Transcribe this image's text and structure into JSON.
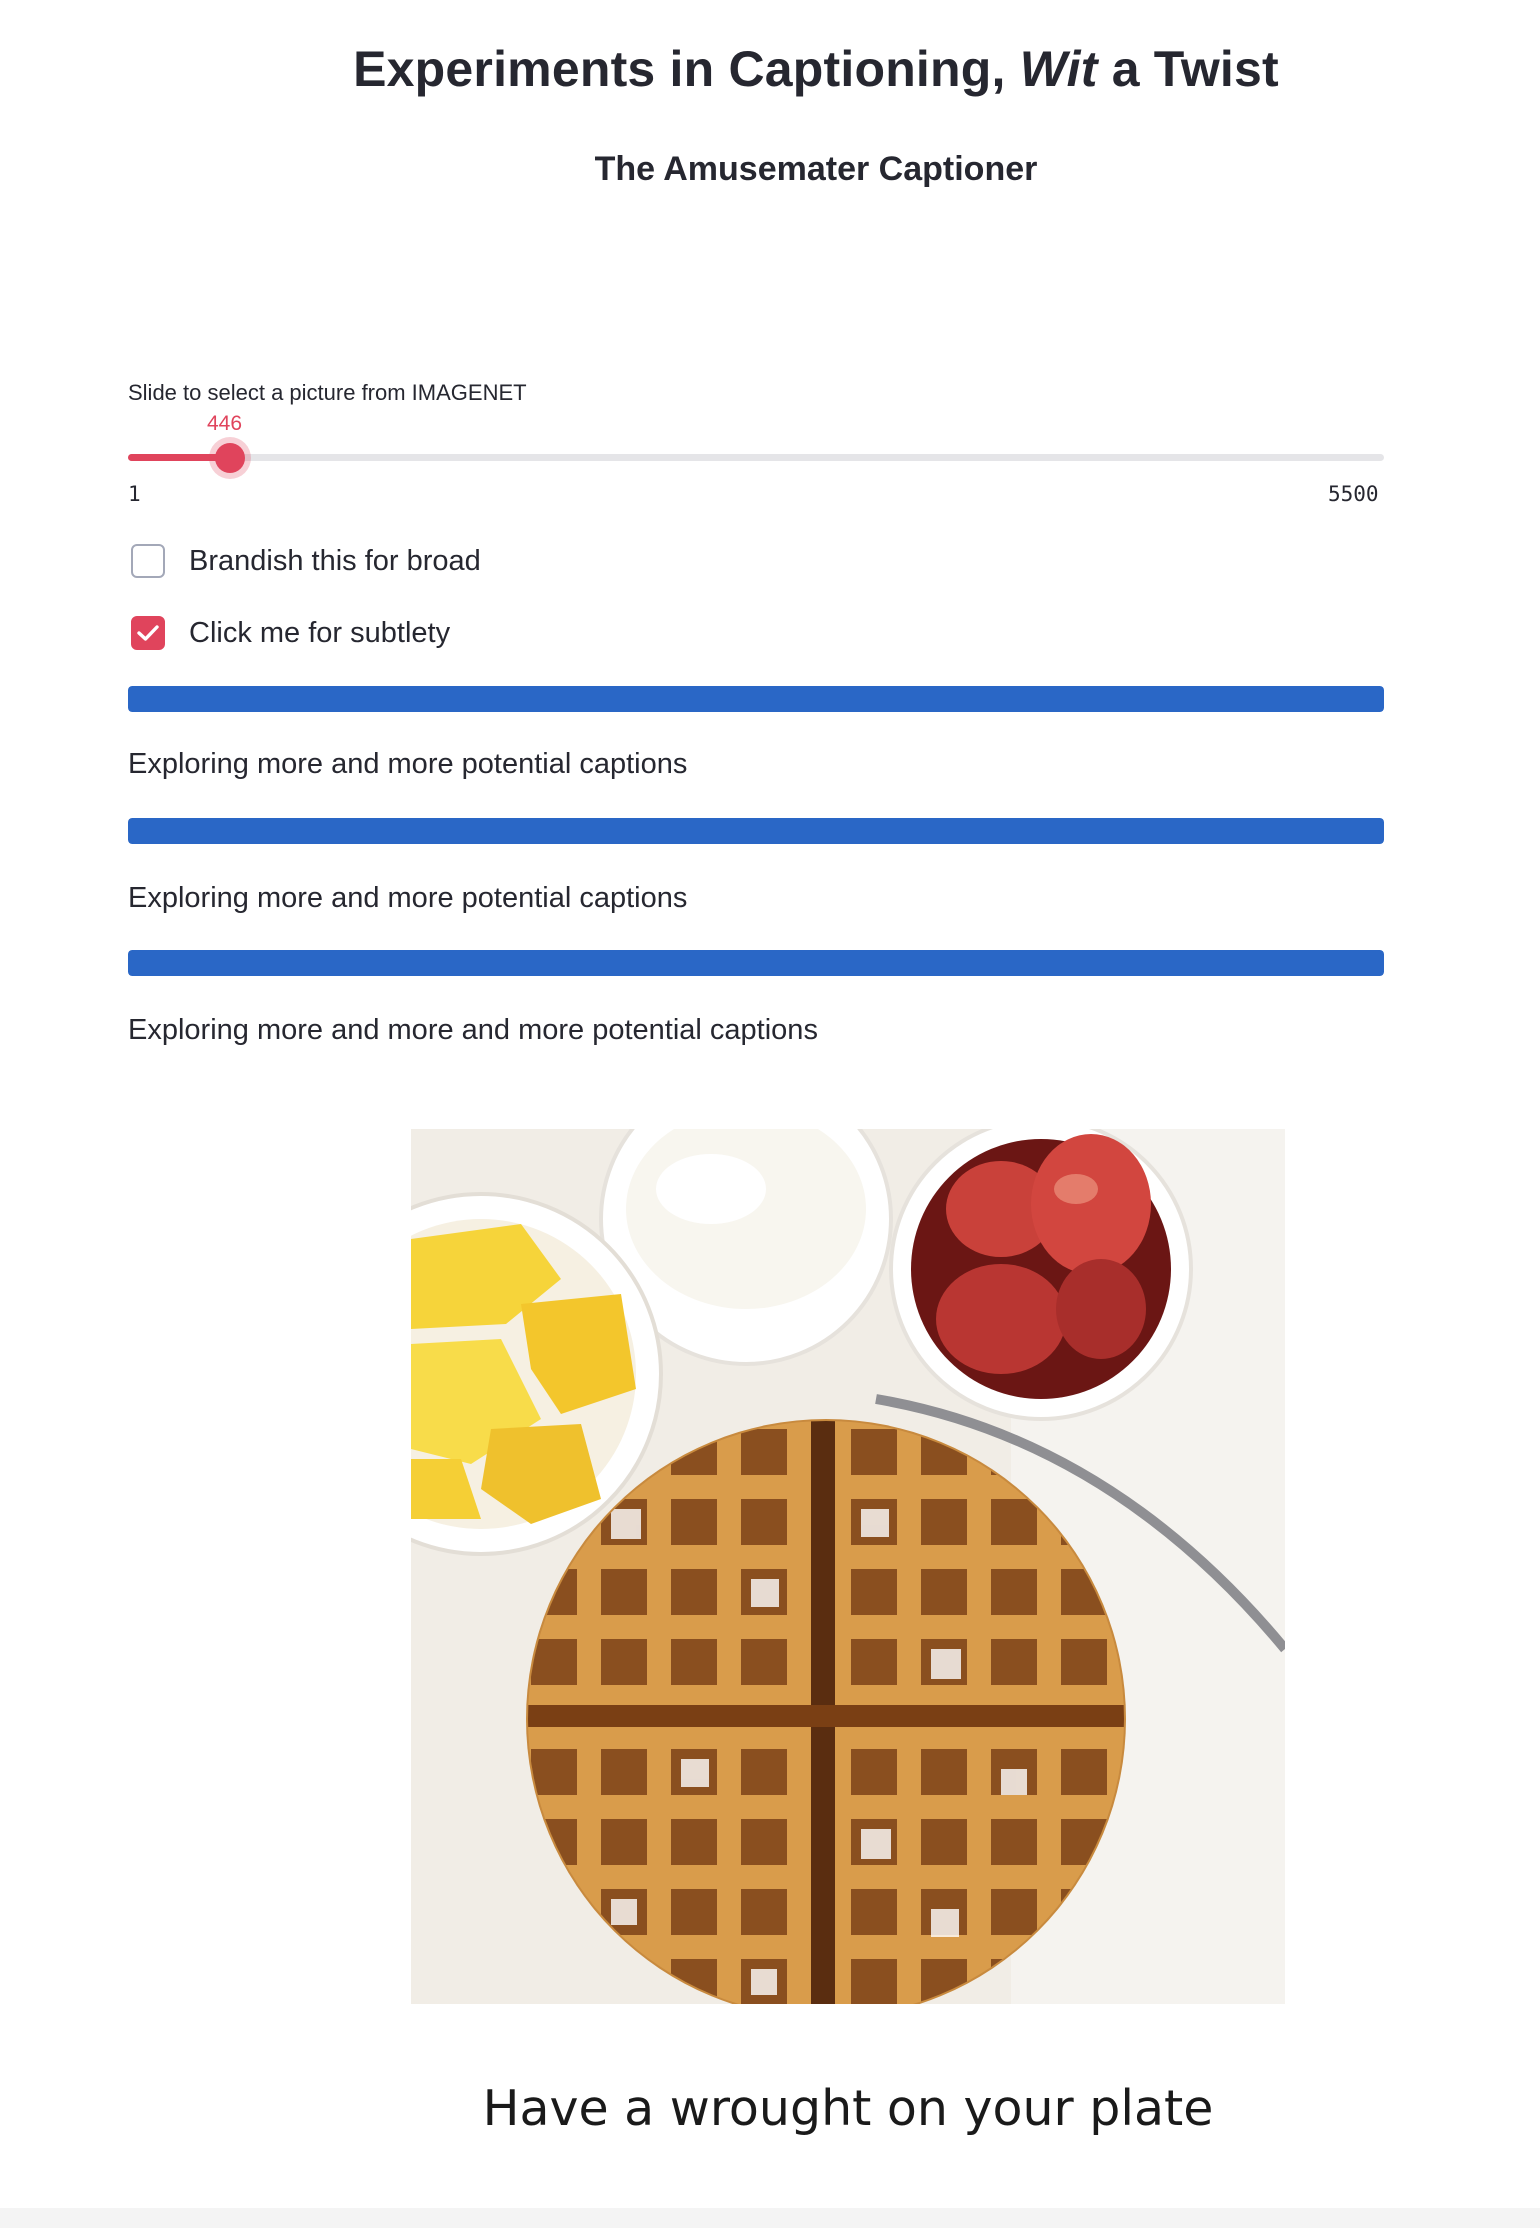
{
  "header": {
    "title_part1": "Experiments in Captioning, ",
    "title_italic": "Wit",
    "title_part2": " a Twist",
    "subtitle": "The Amusemater Captioner"
  },
  "slider": {
    "label": "Slide to select a picture from IMAGENET",
    "value": "446",
    "min": "1",
    "max": "5500",
    "accent_color": "#e0445c"
  },
  "checkboxes": [
    {
      "label": "Brandish this for broad",
      "checked": false
    },
    {
      "label": "Click me for subtlety",
      "checked": true
    }
  ],
  "progress": [
    {
      "value_percent": 100,
      "text": "Exploring more and more potential captions"
    },
    {
      "value_percent": 100,
      "text": "Exploring more and more potential captions"
    },
    {
      "value_percent": 100,
      "text": "Exploring more and more and more potential captions"
    }
  ],
  "progress_color": "#2a67c6",
  "image": {
    "icon": "waffle-with-fruit-photo"
  },
  "caption": "Have a wrought on your plate"
}
